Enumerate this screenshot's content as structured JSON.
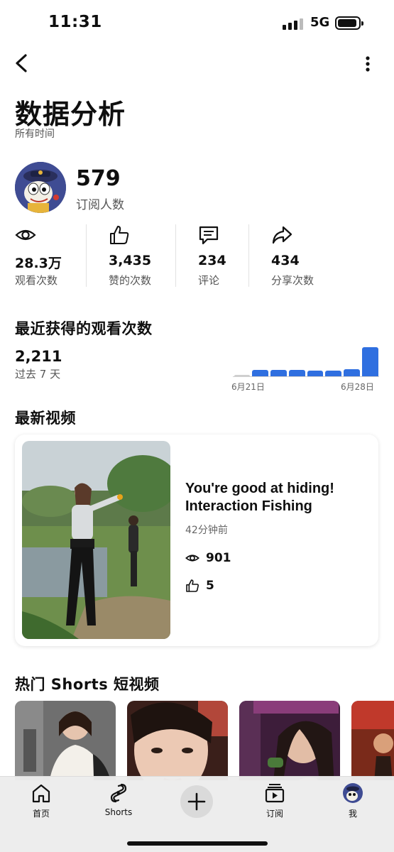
{
  "status_bar": {
    "time": "11:31",
    "network": "5G"
  },
  "header": {
    "title": "数据分析",
    "subtitle": "所有时间"
  },
  "channel": {
    "subscribers": "579",
    "subscribers_label": "订阅人数"
  },
  "stats": [
    {
      "icon": "eye-icon",
      "value": "28.3万",
      "label": "观看次数"
    },
    {
      "icon": "thumbs-up-icon",
      "value": "3,435",
      "label": "赞的次数"
    },
    {
      "icon": "comment-icon",
      "value": "234",
      "label": "评论"
    },
    {
      "icon": "share-icon",
      "value": "434",
      "label": "分享次数"
    }
  ],
  "recent_views": {
    "title": "最近获得的观看次数",
    "value": "2,211",
    "period": "过去 7 天",
    "x_start": "6月21日",
    "x_end": "6月28日"
  },
  "chart_data": {
    "type": "bar",
    "values": [
      0,
      175,
      175,
      175,
      160,
      160,
      190,
      800
    ],
    "ylim": [
      0,
      820
    ],
    "xlabel_start": "6月21日",
    "xlabel_end": "6月28日",
    "colors": {
      "bar": "#2f6fe0",
      "empty": "#cfcfcf"
    }
  },
  "latest_video": {
    "section_title": "最新视频",
    "title": "You're good at hiding! Interaction Fishing",
    "time_ago": "42分钟前",
    "views": "901",
    "likes": "5"
  },
  "shorts": {
    "section_title": "热门 Shorts 短视频"
  },
  "bottom_nav": [
    {
      "label": "首页",
      "icon": "home-icon"
    },
    {
      "label": "Shorts",
      "icon": "shorts-icon"
    },
    {
      "label": "",
      "icon": "plus-icon"
    },
    {
      "label": "订阅",
      "icon": "subscriptions-icon"
    },
    {
      "label": "我",
      "icon": "avatar-icon"
    }
  ],
  "colors": {
    "accent": "#2f6fe0",
    "text": "#0f0f0f",
    "secondary_text": "#555555"
  }
}
